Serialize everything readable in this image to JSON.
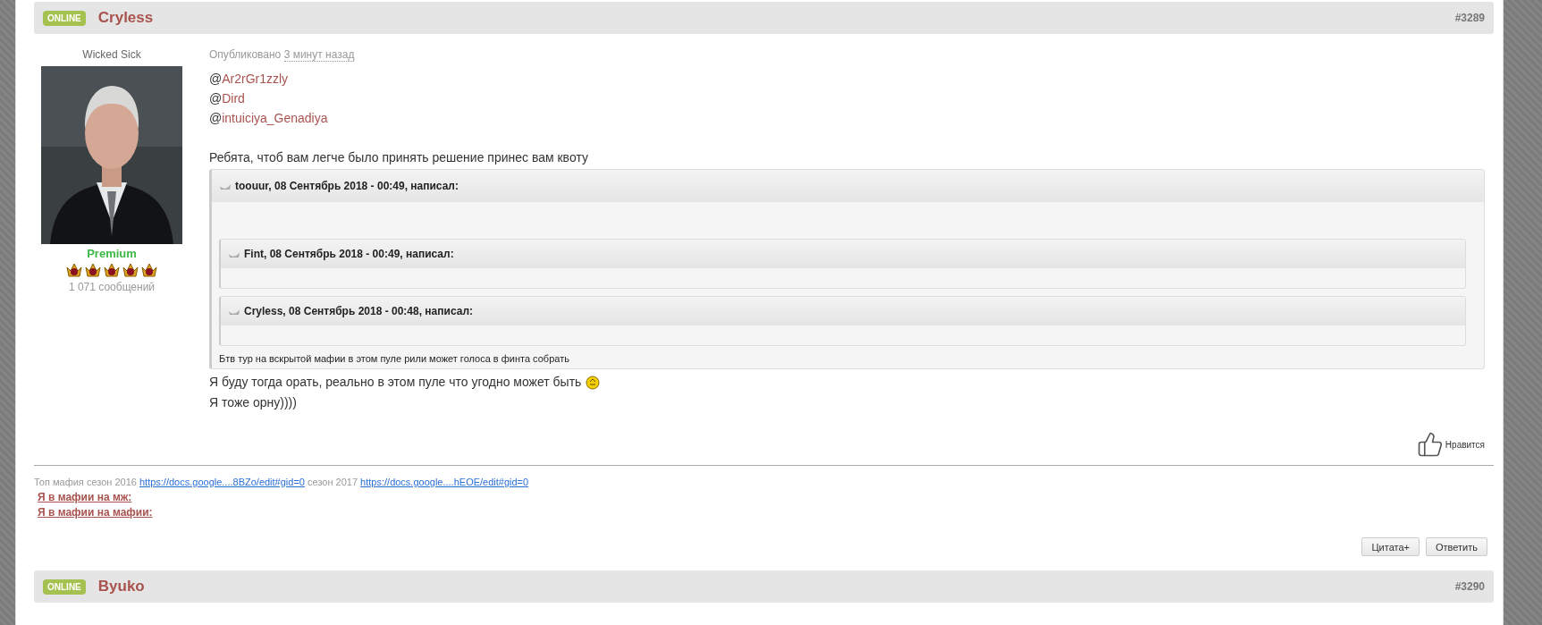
{
  "posts": [
    {
      "status": "ONLINE",
      "author": "Cryless",
      "number": "#3289",
      "rank": "Wicked Sick",
      "avatar": {
        "kind": "picture"
      },
      "group": "Premium",
      "stars": 5,
      "post_count": "1 071 сообщений",
      "published_label": "Опубликовано",
      "published_time": "3 минут назад",
      "mentions": [
        {
          "prefix": "@",
          "name": "Ar2rGr1zzly"
        },
        {
          "prefix": "@",
          "name": "Dird"
        },
        {
          "prefix": "@",
          "name": "intuiciya_Genadiya"
        }
      ],
      "intro": "Ребята, чтоб вам легче было принять решение принес вам квоту",
      "quote": {
        "header": "toouur, 08 Сентябрь 2018 - 00:49, написал:",
        "children": [
          {
            "header": "Fint, 08 Сентябрь 2018 - 00:49, написал:"
          },
          {
            "header": "Cryless, 08 Сентябрь 2018 - 00:48, написал:"
          }
        ],
        "text": "Бтв тур на вскрытой мафии в этом пуле рили может голоса в финта собрать"
      },
      "lines": [
        {
          "text": "Я буду тогда орать, реально в этом пуле что угодно может быть",
          "emoticon": true
        },
        {
          "text": "Я тоже орну))))",
          "emoticon": false
        }
      ],
      "like": "Нравится",
      "signature": {
        "parts": [
          {
            "kind": "text",
            "text": "Топ мафия сезон 2016"
          },
          {
            "kind": "link",
            "text": "https://docs.google....8BZo/edit#gid=0"
          },
          {
            "kind": "text",
            "text": "сезон 2017"
          },
          {
            "kind": "link",
            "text": "https://docs.google....hEOE/edit#gid=0"
          }
        ],
        "links": [
          "Я в мафии на мж:",
          "Я в мафии на мафии:"
        ]
      },
      "buttons": [
        "Цитата+",
        "Ответить"
      ]
    },
    {
      "status": "ONLINE",
      "author": "Byuko",
      "number": "#3290"
    }
  ]
}
